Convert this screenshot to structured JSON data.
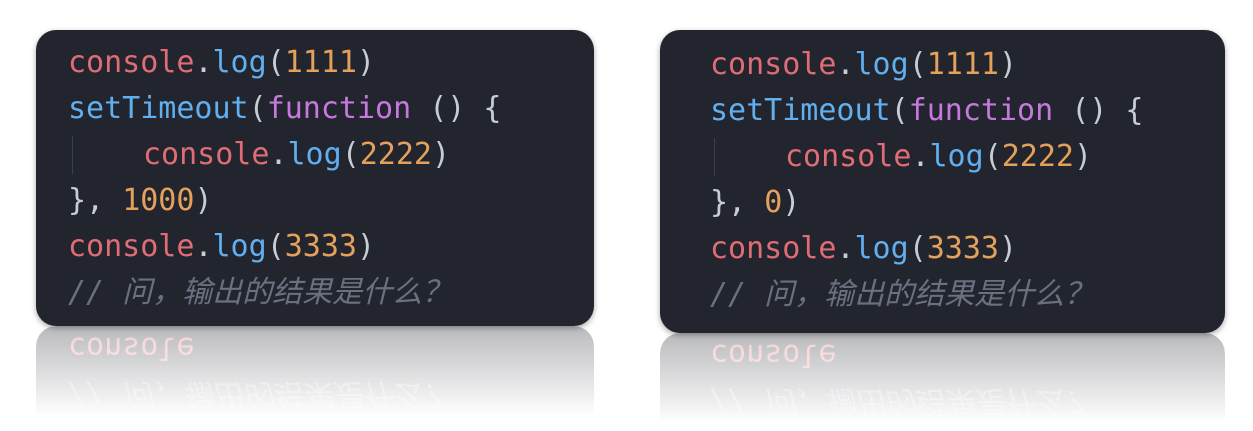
{
  "snippets": [
    {
      "lines": {
        "l1": {
          "obj": "console",
          "dot": ".",
          "fn": "log",
          "open": "(",
          "num": "1111",
          "close": ")"
        },
        "l2": {
          "fn": "setTimeout",
          "open": "(",
          "kw": "function",
          "rest": " () {"
        },
        "l3": {
          "obj": "console",
          "dot": ".",
          "fn": "log",
          "open": "(",
          "num": "2222",
          "close": ")"
        },
        "l4": {
          "pre": "}, ",
          "num": "1000",
          "close": ")"
        },
        "l5": {
          "obj": "console",
          "dot": ".",
          "fn": "log",
          "open": "(",
          "num": "3333",
          "close": ")"
        },
        "l6": {
          "comment": "// 问，输出的结果是什么？"
        }
      }
    },
    {
      "lines": {
        "l1": {
          "obj": "console",
          "dot": ".",
          "fn": "log",
          "open": "(",
          "num": "1111",
          "close": ")"
        },
        "l2": {
          "fn": "setTimeout",
          "open": "(",
          "kw": "function",
          "rest": " () {"
        },
        "l3": {
          "obj": "console",
          "dot": ".",
          "fn": "log",
          "open": "(",
          "num": "2222",
          "close": ")"
        },
        "l4": {
          "pre": "}, ",
          "num": "0",
          "close": ")"
        },
        "l5": {
          "obj": "console",
          "dot": ".",
          "fn": "log",
          "open": "(",
          "num": "3333",
          "close": ")"
        },
        "l6": {
          "comment": "// 问，输出的结果是什么？"
        }
      }
    }
  ],
  "colors": {
    "background": "#ffffff",
    "card": "#22252e",
    "object": "#e06c75",
    "function": "#61afef",
    "keyword": "#c678dd",
    "number": "#e5a15c",
    "punctuation": "#c8ccd4",
    "comment": "#6b7080"
  }
}
